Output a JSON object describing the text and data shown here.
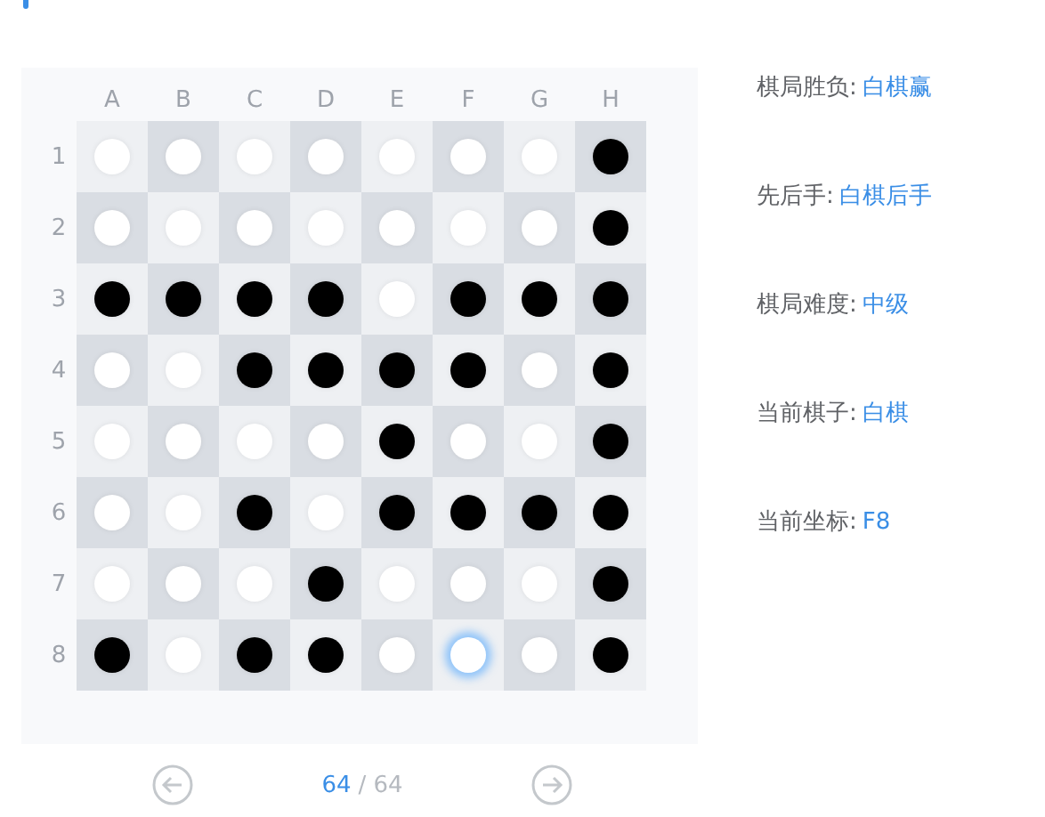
{
  "board": {
    "columns": [
      "A",
      "B",
      "C",
      "D",
      "E",
      "F",
      "G",
      "H"
    ],
    "rows": [
      {
        "label": "1",
        "cells": [
          {
            "color": "#ffffff",
            "highlighted": false
          },
          {
            "color": "#ffffff",
            "highlighted": false
          },
          {
            "color": "#ffffff",
            "highlighted": false
          },
          {
            "color": "#ffffff",
            "highlighted": false
          },
          {
            "color": "#ffffff",
            "highlighted": false
          },
          {
            "color": "#ffffff",
            "highlighted": false
          },
          {
            "color": "#ffffff",
            "highlighted": false
          },
          {
            "color": "#000000",
            "highlighted": false
          }
        ]
      },
      {
        "label": "2",
        "cells": [
          {
            "color": "#ffffff",
            "highlighted": false
          },
          {
            "color": "#ffffff",
            "highlighted": false
          },
          {
            "color": "#ffffff",
            "highlighted": false
          },
          {
            "color": "#ffffff",
            "highlighted": false
          },
          {
            "color": "#ffffff",
            "highlighted": false
          },
          {
            "color": "#ffffff",
            "highlighted": false
          },
          {
            "color": "#ffffff",
            "highlighted": false
          },
          {
            "color": "#000000",
            "highlighted": false
          }
        ]
      },
      {
        "label": "3",
        "cells": [
          {
            "color": "#000000",
            "highlighted": false
          },
          {
            "color": "#000000",
            "highlighted": false
          },
          {
            "color": "#000000",
            "highlighted": false
          },
          {
            "color": "#000000",
            "highlighted": false
          },
          {
            "color": "#ffffff",
            "highlighted": false
          },
          {
            "color": "#000000",
            "highlighted": false
          },
          {
            "color": "#000000",
            "highlighted": false
          },
          {
            "color": "#000000",
            "highlighted": false
          }
        ]
      },
      {
        "label": "4",
        "cells": [
          {
            "color": "#ffffff",
            "highlighted": false
          },
          {
            "color": "#ffffff",
            "highlighted": false
          },
          {
            "color": "#000000",
            "highlighted": false
          },
          {
            "color": "#000000",
            "highlighted": false
          },
          {
            "color": "#000000",
            "highlighted": false
          },
          {
            "color": "#000000",
            "highlighted": false
          },
          {
            "color": "#ffffff",
            "highlighted": false
          },
          {
            "color": "#000000",
            "highlighted": false
          }
        ]
      },
      {
        "label": "5",
        "cells": [
          {
            "color": "#ffffff",
            "highlighted": false
          },
          {
            "color": "#ffffff",
            "highlighted": false
          },
          {
            "color": "#ffffff",
            "highlighted": false
          },
          {
            "color": "#ffffff",
            "highlighted": false
          },
          {
            "color": "#000000",
            "highlighted": false
          },
          {
            "color": "#ffffff",
            "highlighted": false
          },
          {
            "color": "#ffffff",
            "highlighted": false
          },
          {
            "color": "#000000",
            "highlighted": false
          }
        ]
      },
      {
        "label": "6",
        "cells": [
          {
            "color": "#ffffff",
            "highlighted": false
          },
          {
            "color": "#ffffff",
            "highlighted": false
          },
          {
            "color": "#000000",
            "highlighted": false
          },
          {
            "color": "#ffffff",
            "highlighted": false
          },
          {
            "color": "#000000",
            "highlighted": false
          },
          {
            "color": "#000000",
            "highlighted": false
          },
          {
            "color": "#000000",
            "highlighted": false
          },
          {
            "color": "#000000",
            "highlighted": false
          }
        ]
      },
      {
        "label": "7",
        "cells": [
          {
            "color": "#ffffff",
            "highlighted": false
          },
          {
            "color": "#ffffff",
            "highlighted": false
          },
          {
            "color": "#ffffff",
            "highlighted": false
          },
          {
            "color": "#000000",
            "highlighted": false
          },
          {
            "color": "#ffffff",
            "highlighted": false
          },
          {
            "color": "#ffffff",
            "highlighted": false
          },
          {
            "color": "#ffffff",
            "highlighted": false
          },
          {
            "color": "#000000",
            "highlighted": false
          }
        ]
      },
      {
        "label": "8",
        "cells": [
          {
            "color": "#000000",
            "highlighted": false
          },
          {
            "color": "#ffffff",
            "highlighted": false
          },
          {
            "color": "#000000",
            "highlighted": false
          },
          {
            "color": "#000000",
            "highlighted": false
          },
          {
            "color": "#ffffff",
            "highlighted": false
          },
          {
            "color": "#ffffff",
            "highlighted": true
          },
          {
            "color": "#ffffff",
            "highlighted": false
          },
          {
            "color": "#000000",
            "highlighted": false
          }
        ]
      }
    ]
  },
  "info": [
    {
      "label": "棋局胜负:",
      "value": "白棋赢"
    },
    {
      "label": "先后手:",
      "value": "白棋后手"
    },
    {
      "label": "棋局难度:",
      "value": "中级"
    },
    {
      "label": "当前棋子:",
      "value": "白棋"
    },
    {
      "label": "当前坐标:",
      "value": "F8"
    }
  ],
  "pager": {
    "current": "64",
    "separator": "/",
    "total": "64"
  }
}
